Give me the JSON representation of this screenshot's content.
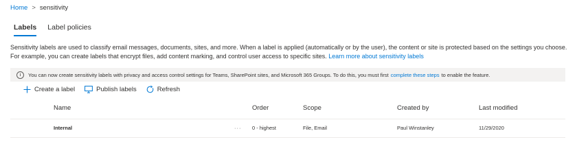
{
  "breadcrumb": {
    "home": "Home",
    "separator": ">",
    "current": "sensitivity"
  },
  "tabs": [
    {
      "label": "Labels",
      "active": true
    },
    {
      "label": "Label policies",
      "active": false
    }
  ],
  "description": {
    "text": "Sensitivity labels are used to classify email messages, documents, sites, and more. When a label is applied (automatically or by the user), the content or site is protected based on the settings you choose. For example, you can create labels that encrypt files, add content marking, and control user access to specific sites.",
    "link": "Learn more about sensitivity labels"
  },
  "banner": {
    "icon": "info-icon",
    "text_before": "You can now create sensitivity labels with privacy and access control settings for Teams, SharePoint sites, and Microsoft 365 Groups. To do this, you must first",
    "link": "complete these steps",
    "text_after": "to enable the feature."
  },
  "toolbar": {
    "create_label": "Create a label",
    "publish_labels": "Publish labels",
    "refresh": "Refresh"
  },
  "table": {
    "columns": {
      "name": "Name",
      "order": "Order",
      "scope": "Scope",
      "created_by": "Created by",
      "last_modified": "Last modified"
    },
    "rows": [
      {
        "name": "Internal",
        "more": "···",
        "order": "0 - highest",
        "scope": "File, Email",
        "created_by": "Paul Winstanley",
        "last_modified": "11/29/2020"
      }
    ]
  },
  "colors": {
    "accent": "#0078d4",
    "banner_bg": "#f3f2f1",
    "text": "#323130"
  }
}
